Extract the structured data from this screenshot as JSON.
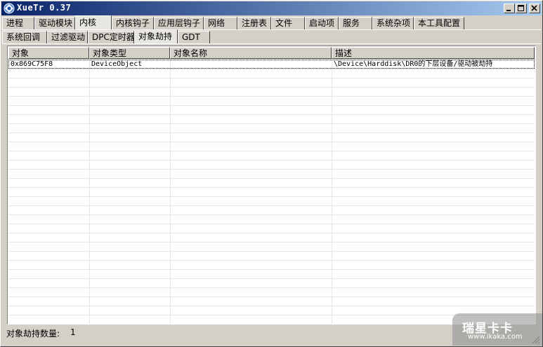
{
  "window": {
    "title": "XueTr 0.37"
  },
  "main_tabs": [
    "进程",
    "驱动模块",
    "内核",
    "内核钩子",
    "应用层钩子",
    "网络",
    "注册表",
    "文件",
    "启动项",
    "服务",
    "系统杂项",
    "本工具配置"
  ],
  "main_tab_active": "内核",
  "sub_tabs": [
    "系统回调",
    "过滤驱动",
    "DPC定时器",
    "对象劫持",
    "GDT"
  ],
  "sub_tab_active": "对象劫持",
  "table": {
    "columns": [
      "对象",
      "对象类型",
      "对象名称",
      "描述"
    ],
    "rows": [
      {
        "object": "0x869C75F8",
        "type": "DeviceObject",
        "name": "",
        "desc": "\\Device\\Harddisk\\DR0的下层设备/驱动被劫持"
      }
    ]
  },
  "status": {
    "label": "对象劫持数量:",
    "count": "1"
  },
  "watermark": {
    "brand": "瑞星卡卡",
    "url": "www.ikaka.com"
  },
  "colors": {
    "title_start": "#0a246a",
    "title_end": "#a6caf0",
    "face": "#d4d0c8"
  }
}
